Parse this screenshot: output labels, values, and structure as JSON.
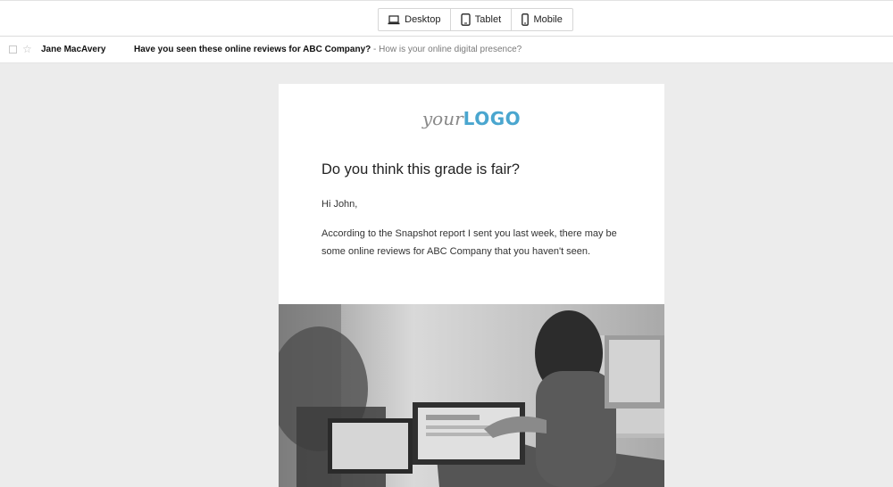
{
  "device_toggle": {
    "desktop_label": "Desktop",
    "tablet_label": "Tablet",
    "mobile_label": "Mobile",
    "desktop_icon": "laptop-icon",
    "tablet_icon": "tablet-icon",
    "mobile_icon": "phone-icon"
  },
  "inbox_row": {
    "sender": "Jane MacAvery",
    "subject": "Have you seen these online reviews for ABC Company?",
    "preview": " - How is your online digital presence?"
  },
  "email": {
    "logo_prefix": "your",
    "logo_main": "LOGO",
    "headline": "Do you think this grade is fair?",
    "greeting": "Hi John,",
    "body": "According to the Snapshot report I sent you last week, there may be some online reviews for ABC Company that you haven't seen."
  },
  "colors": {
    "logo_accent": "#4aa6cf",
    "background": "#ececec"
  }
}
